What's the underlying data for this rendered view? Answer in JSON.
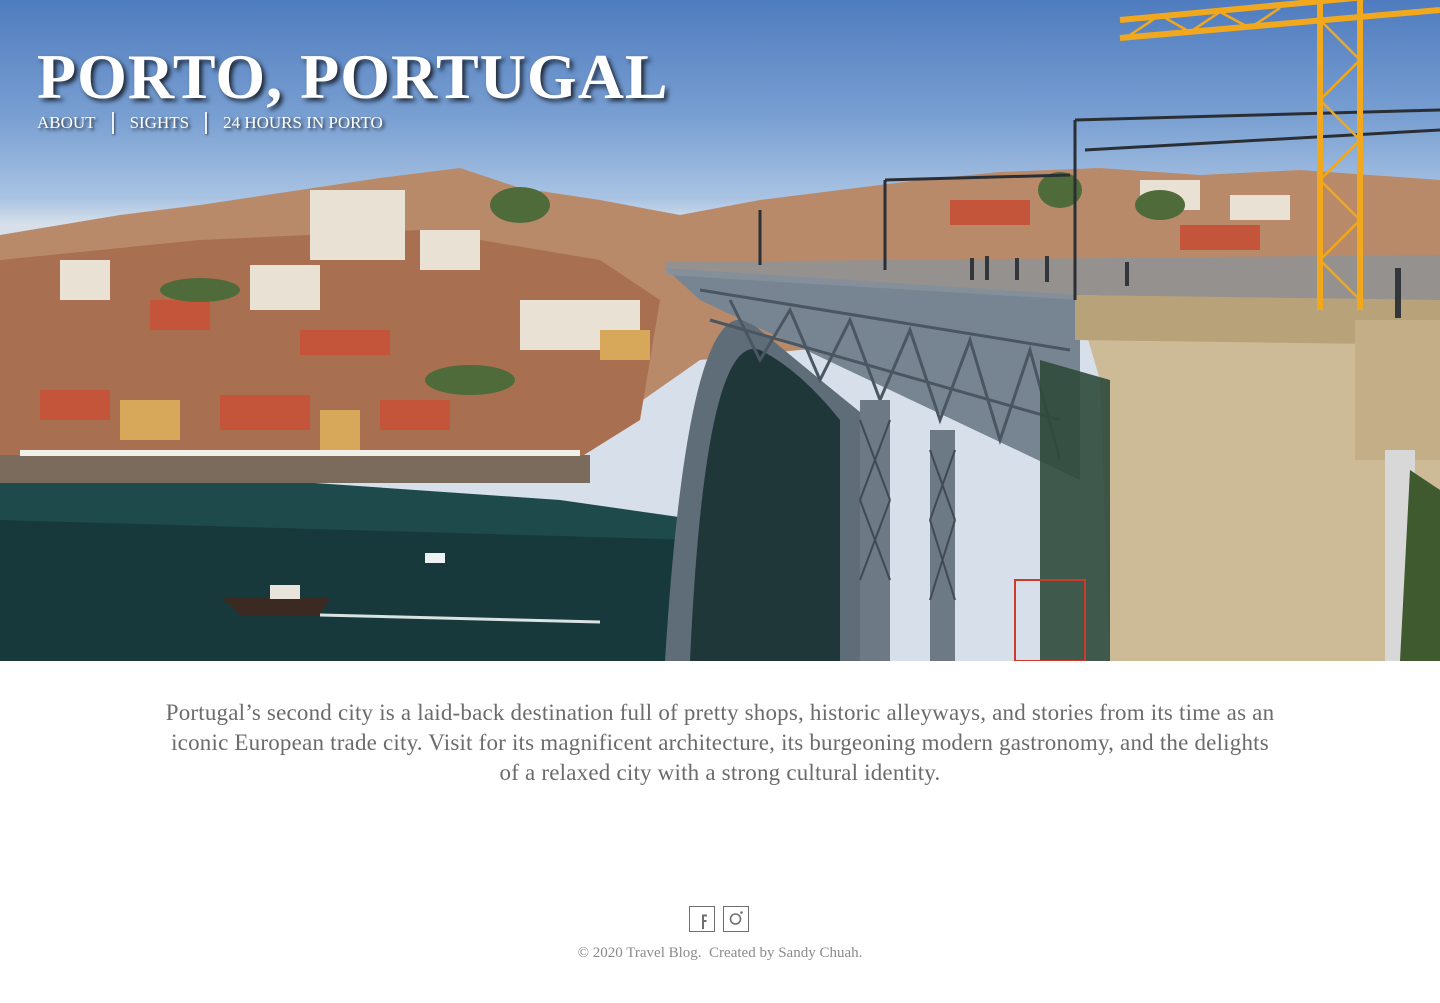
{
  "site": {
    "title": "PORTO, PORTUGAL"
  },
  "nav": {
    "items": [
      {
        "label": "ABOUT"
      },
      {
        "label": "SIGHTS"
      },
      {
        "label": "24 HOURS IN PORTO"
      }
    ]
  },
  "intro": {
    "text": "Portugal’s second city is a laid-back destination full of pretty shops, historic alleyways, and stories from its time as an iconic European trade city. Visit for its magnificent architecture, its burgeoning modern gastronomy, and the delights of a relaxed city with a strong cultural identity."
  },
  "social": {
    "facebook_icon": "facebook-icon",
    "instagram_icon": "instagram-icon"
  },
  "footer": {
    "copyright": "© 2020 Travel Blog.",
    "credit": "Created by Sandy Chuah."
  },
  "colors": {
    "text_white": "#ffffff",
    "body_text": "#6b6b6b",
    "footer_text": "#8a8a8a",
    "sky": "#6f96cc",
    "river": "#1f4a4c",
    "bridge": "#6d7a85",
    "crane": "#f2a81c"
  }
}
